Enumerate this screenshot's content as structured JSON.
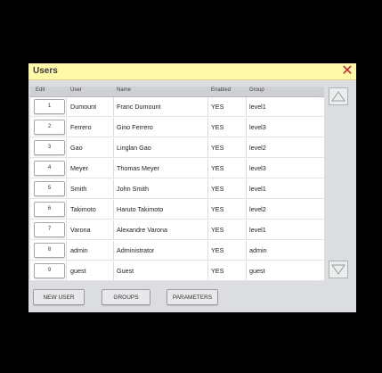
{
  "window": {
    "title": "Users"
  },
  "columns": {
    "edit": "Edit",
    "user": "User",
    "name": "Name",
    "enabled": "Enabled",
    "group": "Group"
  },
  "rows": [
    {
      "edit": "1",
      "user": "Dumount",
      "name": "Franc Dumount",
      "enabled": "YES",
      "group": "level1"
    },
    {
      "edit": "2",
      "user": "Ferrero",
      "name": "Gino Ferrero",
      "enabled": "YES",
      "group": "level3"
    },
    {
      "edit": "3",
      "user": "Gao",
      "name": "Linglan Gao",
      "enabled": "YES",
      "group": "level2"
    },
    {
      "edit": "4",
      "user": "Meyer",
      "name": "Thomas Meyer",
      "enabled": "YES",
      "group": "level3"
    },
    {
      "edit": "5",
      "user": "Smith",
      "name": "John Smith",
      "enabled": "YES",
      "group": "level1"
    },
    {
      "edit": "6",
      "user": "Takimoto",
      "name": "Haruto Takimoto",
      "enabled": "YES",
      "group": "level2"
    },
    {
      "edit": "7",
      "user": "Varona",
      "name": "Alexandre Varona",
      "enabled": "YES",
      "group": "level1"
    },
    {
      "edit": "8",
      "user": "admin",
      "name": "Administrator",
      "enabled": "YES",
      "group": "admin"
    },
    {
      "edit": "9",
      "user": "guest",
      "name": "Guest",
      "enabled": "YES",
      "group": "guest"
    }
  ],
  "buttons": {
    "new_user": "NEW USER",
    "groups": "GROUPS",
    "parameters": "PARAMETERS"
  },
  "colors": {
    "title_bar": "#fff9a8",
    "close": "#c8203a",
    "panel": "#dcdde0"
  },
  "icons": {
    "close": "close-icon",
    "scroll_up": "triangle-up-icon",
    "scroll_down": "triangle-down-icon"
  }
}
